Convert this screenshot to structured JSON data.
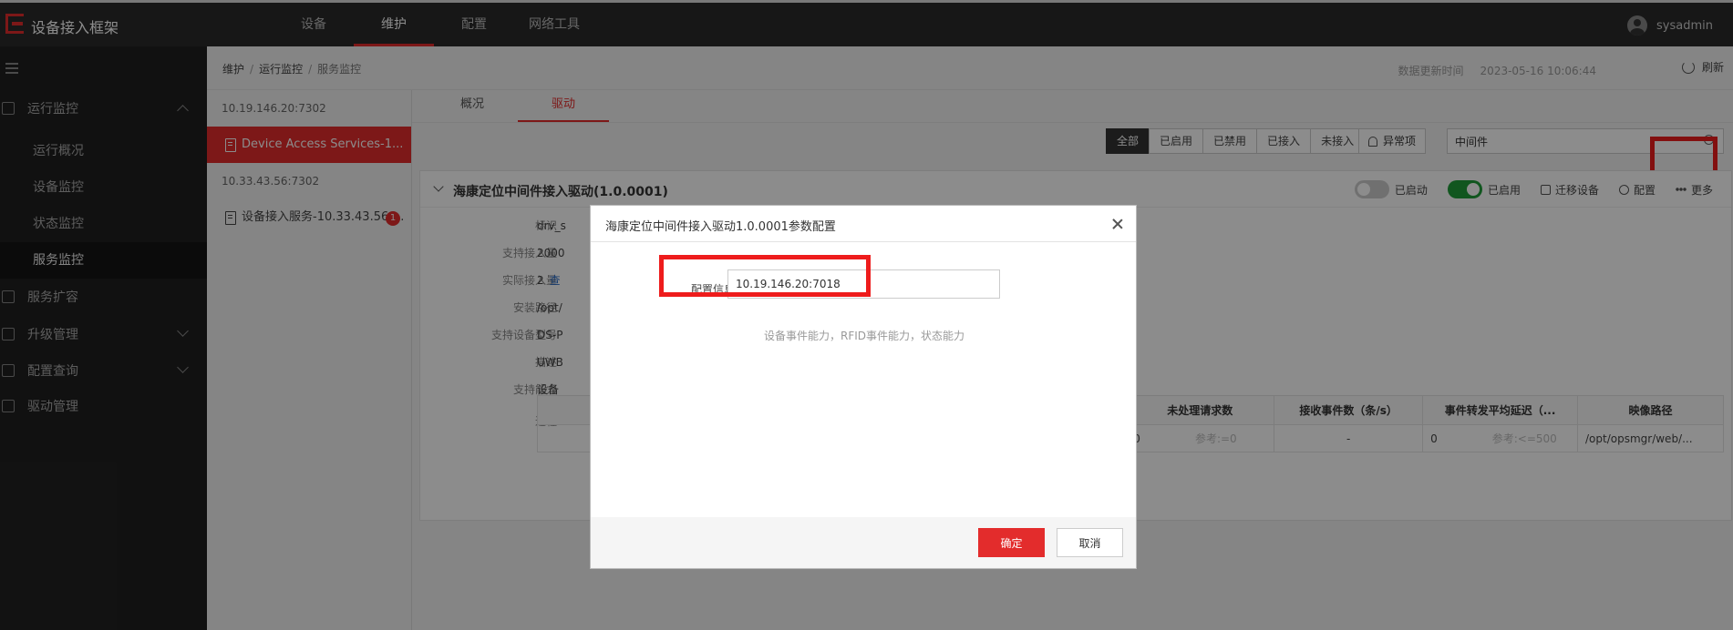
{
  "app": {
    "title": "设备接入框架"
  },
  "nav": {
    "items": [
      "设备",
      "维护",
      "配置",
      "网络工具"
    ],
    "active": "维护"
  },
  "user": {
    "name": "sysadmin"
  },
  "sidebar": {
    "groups": [
      {
        "label": "运行监控",
        "expanded": true,
        "children": [
          "运行概况",
          "设备监控",
          "状态监控",
          "服务监控"
        ],
        "active_child": "服务监控"
      },
      {
        "label": "服务扩容"
      },
      {
        "label": "升级管理",
        "expanded": false
      },
      {
        "label": "配置查询",
        "expanded": false
      },
      {
        "label": "驱动管理"
      }
    ]
  },
  "breadcrumb": {
    "items": [
      "维护",
      "运行监控",
      "服务监控"
    ]
  },
  "update": {
    "label": "数据更新时间",
    "time": "2023-05-16 10:06:44",
    "refresh_label": "刷新"
  },
  "services": [
    {
      "host": "10.19.146.20:7302",
      "items": [
        {
          "name": "Device Access Services-1...",
          "active": true
        }
      ]
    },
    {
      "host": "10.33.43.56:7302",
      "items": [
        {
          "name": "设备接入服务-10.33.43.56-...",
          "badge": "1"
        }
      ]
    }
  ],
  "tabs": [
    "概况",
    "驱动"
  ],
  "active_tab": "驱动",
  "filters": [
    "全部",
    "已启用",
    "已禁用",
    "已接入",
    "未接入"
  ],
  "active_filter": "全部",
  "alert_label": "异常项",
  "search": {
    "value": "中间件"
  },
  "driver": {
    "title": "海康定位中间件接入驱动(1.0.0001)",
    "started_label": "已启动",
    "enabled_label": "已启用",
    "actions": [
      "迁移设备",
      "配置",
      "更多"
    ],
    "props": [
      {
        "label": "标识",
        "value": "drv_s"
      },
      {
        "label": "支持接入量",
        "value": "2000"
      },
      {
        "label": "实际接入量",
        "value": "2",
        "link": "查"
      },
      {
        "label": "安装路径",
        "value": "/opt/"
      },
      {
        "label": "支持设备型号",
        "value": "DS-P"
      },
      {
        "label": "描述",
        "value": "UWB"
      },
      {
        "label": "支持能力",
        "value": "设备"
      }
    ],
    "process_label": "进程",
    "table": {
      "headers": [
        "未处理请求数",
        "接收事件数（条/s）",
        "事件转发平均延迟（...",
        "映像路径"
      ],
      "row": {
        "pending": "0",
        "pending_ref": "参考:=0",
        "events": "-",
        "delay": "0",
        "delay_ref": "参考:<=500",
        "path": "/opt/opsmgr/web/..."
      }
    }
  },
  "modal": {
    "title": "海康定位中间件接入驱动1.0.0001参数配置",
    "field_label": "配置信息",
    "field_value": "10.19.146.20:7018",
    "hint": "设备事件能力，RFID事件能力，状态能力",
    "ok_label": "确定",
    "cancel_label": "取消"
  },
  "colors": {
    "accent": "#e32c2c",
    "topbar": "#2b2b2b",
    "sidebar": "#202020",
    "enabled": "#1f9d3a",
    "highlight": "#ee1c1c"
  }
}
